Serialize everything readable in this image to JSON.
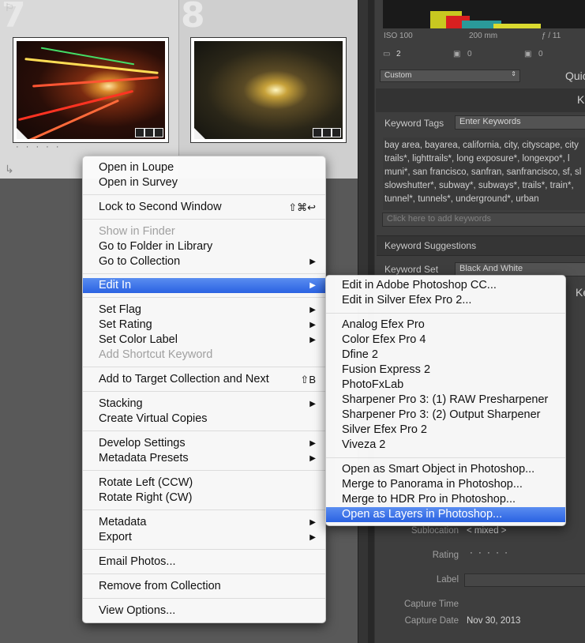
{
  "grid": {
    "cell1_number": "7",
    "cell2_number": "8",
    "rating_dots": "· · · · ·"
  },
  "histogram": {
    "iso": "ISO 100",
    "focal": "200 mm",
    "aperture": "ƒ / 11",
    "count_a": "2",
    "count_b": "0",
    "count_c": "0"
  },
  "panel": {
    "preset_select": "Custom",
    "quick_label": "Quic",
    "k_label": "K",
    "keyword_tags_label": "Keyword Tags",
    "keyword_tags_value": "Enter Keywords",
    "keywords_text": "bay area, bayarea, california, city, cityscape, city\ntrails*, lighttrails*, long exposure*, longexpo*, l\nmuni*, san francisco, sanfran, sanfrancisco, sf, sl\nslowshutter*, subway*, subways*, trails*, train*,\ntunnel*, tunnels*, underground*, urban",
    "add_keywords_placeholder": "Click here to add keywords",
    "keyword_suggestions_label": "Keyword Suggestions",
    "keyword_set_label": "Keyword Set",
    "keyword_set_value": "Black And White",
    "k2_label": "Ke",
    "sublocation_label": "Sublocation",
    "sublocation_value": "< mixed >",
    "rating_label": "Rating",
    "rating_value": "· · · · ·",
    "label_label": "Label",
    "capture_time_label": "Capture Time",
    "capture_date_label": "Capture Date",
    "capture_date_value": "Nov 30, 2013"
  },
  "context_menu": {
    "items": [
      {
        "label": "Open in Loupe"
      },
      {
        "label": "Open in Survey"
      },
      {
        "label": "Lock to Second Window",
        "shortcut": "⇧⌘↩"
      },
      {
        "label": "Show in Finder",
        "disabled": true
      },
      {
        "label": "Go to Folder in Library"
      },
      {
        "label": "Go to Collection",
        "submenu": true
      },
      {
        "label": "Edit In",
        "submenu": true,
        "selected": true
      },
      {
        "label": "Set Flag",
        "submenu": true
      },
      {
        "label": "Set Rating",
        "submenu": true
      },
      {
        "label": "Set Color Label",
        "submenu": true
      },
      {
        "label": "Add Shortcut Keyword",
        "disabled": true
      },
      {
        "label": "Add to Target Collection and Next",
        "shortcut": "⇧B"
      },
      {
        "label": "Stacking",
        "submenu": true
      },
      {
        "label": "Create Virtual Copies"
      },
      {
        "label": "Develop Settings",
        "submenu": true
      },
      {
        "label": "Metadata Presets",
        "submenu": true
      },
      {
        "label": "Rotate Left (CCW)"
      },
      {
        "label": "Rotate Right (CW)"
      },
      {
        "label": "Metadata",
        "submenu": true
      },
      {
        "label": "Export",
        "submenu": true
      },
      {
        "label": "Email Photos..."
      },
      {
        "label": "Remove from Collection"
      },
      {
        "label": "View Options..."
      }
    ],
    "arrow_glyph": "▶"
  },
  "edit_in_submenu": {
    "items": [
      {
        "label": "Edit in Adobe Photoshop CC..."
      },
      {
        "label": "Edit in Silver Efex Pro 2..."
      },
      {
        "label": "Analog Efex Pro"
      },
      {
        "label": "Color Efex Pro 4"
      },
      {
        "label": "Dfine 2"
      },
      {
        "label": "Fusion Express 2"
      },
      {
        "label": "PhotoFxLab"
      },
      {
        "label": "Sharpener Pro 3: (1) RAW Presharpener"
      },
      {
        "label": "Sharpener Pro 3: (2) Output Sharpener"
      },
      {
        "label": "Silver Efex Pro 2"
      },
      {
        "label": "Viveza 2"
      },
      {
        "label": "Open as Smart Object in Photoshop..."
      },
      {
        "label": "Merge to Panorama in Photoshop..."
      },
      {
        "label": "Merge to HDR Pro in Photoshop..."
      },
      {
        "label": "Open as Layers in Photoshop...",
        "selected": true
      }
    ]
  },
  "colors": {
    "menu_highlight": "#2a62e2",
    "panel_bg": "#3e3e3e",
    "grid_bg": "#595959"
  }
}
